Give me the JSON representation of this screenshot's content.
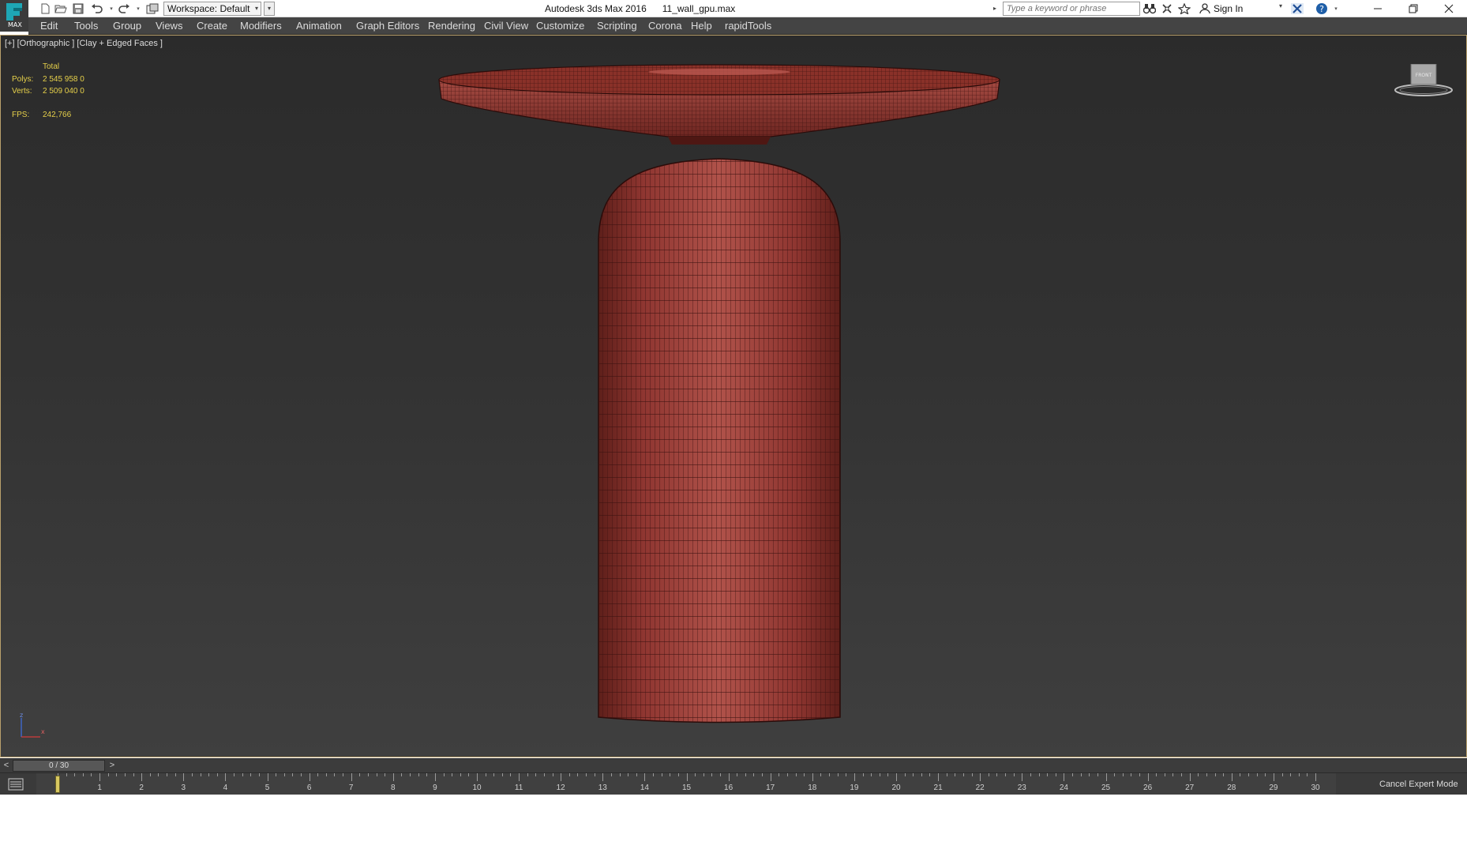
{
  "titlebar": {
    "logo_text": "MAX",
    "workspace": "Workspace: Default",
    "window_title": "Autodesk 3ds Max 2016      11_wall_gpu.max",
    "search_placeholder": "Type a keyword or phrase",
    "sign_in": "Sign In",
    "icons": [
      "new-file-icon",
      "open-file-icon",
      "save-file-icon",
      "undo-icon",
      "redo-icon",
      "project-folder-icon",
      "binoculars-icon",
      "autodesk-exchange-icon",
      "favorites-star-icon",
      "user-icon",
      "x-icon",
      "help-icon"
    ]
  },
  "menubar": {
    "items": [
      "Edit",
      "Tools",
      "Group",
      "Views",
      "Create",
      "Modifiers",
      "Animation",
      "Graph Editors",
      "Rendering",
      "Civil View",
      "Customize",
      "Scripting",
      "Corona",
      "Help",
      "rapidTools"
    ]
  },
  "viewport": {
    "label": "[+] [Orthographic ] [Clay + Edged Faces ]",
    "stats": {
      "header": "Total",
      "polys_label": "Polys:",
      "polys_value": "2 545 958   0",
      "verts_label": "Verts:",
      "verts_value": "2 509 040   0",
      "fps_label": "FPS:",
      "fps_value": "242,766"
    },
    "viewcube_label": "FRONT",
    "model_color": "#9c3f38",
    "wire_color": "#4d1714",
    "axis_labels": {
      "z": "z",
      "x": "x"
    }
  },
  "timeline": {
    "prev": "<",
    "position": "0 / 30",
    "next": ">",
    "frames": [
      "0",
      "1",
      "2",
      "3",
      "4",
      "5",
      "6",
      "7",
      "8",
      "9",
      "10",
      "11",
      "12",
      "13",
      "14",
      "15",
      "16",
      "17",
      "18",
      "19",
      "20",
      "21",
      "22",
      "23",
      "24",
      "25",
      "26",
      "27",
      "28",
      "29",
      "30"
    ],
    "current_frame": 0,
    "cancel_expert": "Cancel Expert Mode"
  }
}
